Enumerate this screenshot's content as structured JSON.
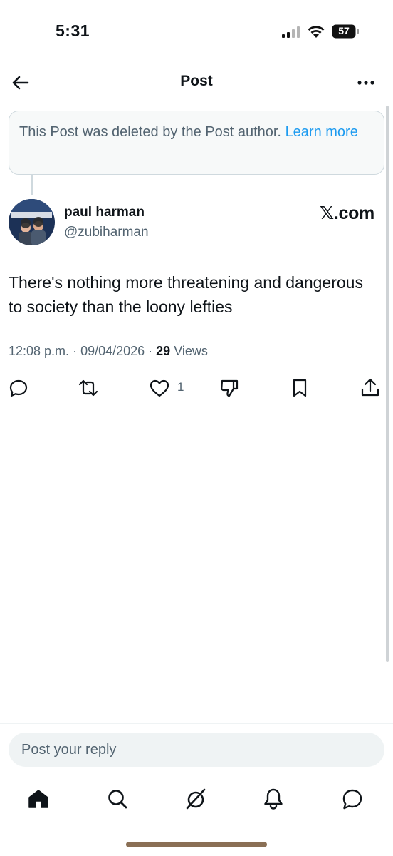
{
  "status_bar": {
    "time": "5:31",
    "battery": "57"
  },
  "header": {
    "title": "Post"
  },
  "deleted_notice": {
    "text": "This Post was deleted by the Post author.",
    "link": "Learn more"
  },
  "post": {
    "author_name": "paul harman",
    "author_handle": "@zubiharman",
    "source_badge": "𝕏.com",
    "text": "There's nothing more threatening and dangerous to society than the loony lefties",
    "time": "12:08 p.m.",
    "date": "09/04/2026",
    "views_count": "29",
    "views_label": "Views",
    "like_count": "1"
  },
  "actions": [
    "reply-icon",
    "repost-icon",
    "like-icon",
    "dislike-icon",
    "bookmark-icon",
    "share-icon"
  ],
  "reply": {
    "placeholder": "Post your reply"
  },
  "tabbar": [
    "home-icon",
    "search-icon",
    "grok-icon",
    "notifications-icon",
    "messages-icon"
  ],
  "colors": {
    "accent": "#1d9bf0",
    "text": "#0f1419",
    "secondary": "#536471"
  }
}
